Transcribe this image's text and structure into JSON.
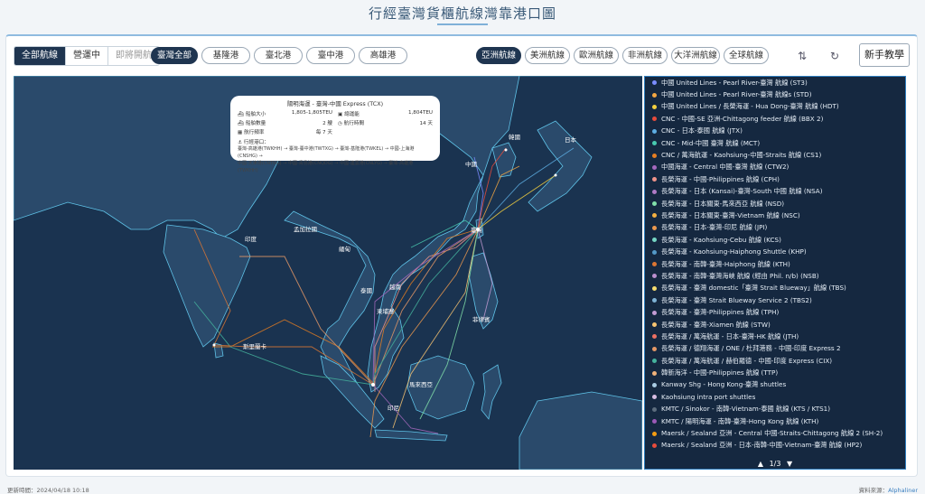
{
  "page": {
    "title": "行經臺灣貨櫃航線灣靠港口圖"
  },
  "toolbar": {
    "route_type": [
      {
        "label": "全部航線",
        "active": true
      },
      {
        "label": "營運中",
        "active": false
      },
      {
        "label": "即將開航",
        "active": false,
        "disabled": true
      }
    ],
    "ports": [
      {
        "label": "臺灣全部",
        "active": true
      },
      {
        "label": "基隆港",
        "active": false
      },
      {
        "label": "臺北港",
        "active": false
      },
      {
        "label": "臺中港",
        "active": false
      },
      {
        "label": "高雄港",
        "active": false
      }
    ],
    "regions": [
      {
        "label": "亞洲航線",
        "active": true
      },
      {
        "label": "美洲航線",
        "active": false
      },
      {
        "label": "歐洲航線",
        "active": false
      },
      {
        "label": "非洲航線",
        "active": false
      },
      {
        "label": "大洋洲航線",
        "active": false
      },
      {
        "label": "全球航線",
        "active": false
      }
    ],
    "sort_icon": "sort-arrows-icon",
    "refresh_icon": "refresh-icon",
    "tutorial_label": "新手教學"
  },
  "infobox": {
    "title": "陽明海運 - 臺灣-中國 Express (TCX)",
    "fields": [
      {
        "icon": "ship-icon",
        "label": "船舶大小",
        "value": "1,805-1,805TEU"
      },
      {
        "icon": "container-icon",
        "label": "總運能",
        "value": "1,804TEU"
      },
      {
        "icon": "ship-icon",
        "label": "船舶數量",
        "value": "2 艘"
      },
      {
        "icon": "clock-icon",
        "label": "航行時間",
        "value": "14 天"
      },
      {
        "icon": "calendar-icon",
        "label": "航行頻率",
        "value": "每 7 天"
      }
    ],
    "ports_title": "行經港口：",
    "ports_line1": "臺灣-高雄港(TWKHH) → 臺灣-臺中港(TWTXG) → 臺灣-基隆港(TWKEL) → 中國-上海港(CNSHG) →",
    "ports_line2": "中國-天津港(CNTNG) → 中國-青島港(CNQDG) → 中國-連雲港(CNLYG) → 臺灣-高雄港(TWKHH)"
  },
  "map": {
    "labels": [
      {
        "id": "korea",
        "text": "韓國"
      },
      {
        "id": "japan",
        "text": "日本"
      },
      {
        "id": "china",
        "text": "中國"
      },
      {
        "id": "taiwan",
        "text": "臺灣"
      },
      {
        "id": "india",
        "text": "印度"
      },
      {
        "id": "bangladesh",
        "text": "孟加拉國"
      },
      {
        "id": "myanmar",
        "text": "緬甸"
      },
      {
        "id": "thailand",
        "text": "泰國"
      },
      {
        "id": "cambodia",
        "text": "柬埔寨"
      },
      {
        "id": "vietnam",
        "text": "越南"
      },
      {
        "id": "philippines",
        "text": "菲律賓"
      },
      {
        "id": "srilanka",
        "text": "斯里蘭卡"
      },
      {
        "id": "malaysia",
        "text": "馬來西亞"
      },
      {
        "id": "indonesia",
        "text": "印尼"
      }
    ]
  },
  "legend": {
    "items": [
      {
        "label": "中國 United Lines - Pearl River-臺灣 航線 (ST3)",
        "color": "#7b8cff"
      },
      {
        "label": "中國 United Lines - Pearl River-臺灣 航線s (STD)",
        "color": "#f4a742"
      },
      {
        "label": "中國 United Lines / 長榮海運 - Hua Dong-臺灣 航線 (HDT)",
        "color": "#f4d03f"
      },
      {
        "label": "CNC - 中國-SE 亞洲-Chittagong feeder 航線 (BBX 2)",
        "color": "#e74c3c"
      },
      {
        "label": "CNC - 日本-泰國 航線 (JTX)",
        "color": "#5dade2"
      },
      {
        "label": "CNC - Mid-中國 臺灣 航線 (MCT)",
        "color": "#48c9b0"
      },
      {
        "label": "CNC / 萬海航運 - Kaohsiung-中國-Straits 航線 (CS1)",
        "color": "#e67e22"
      },
      {
        "label": "中國海運 - Central 中國-臺灣 航線 (CTW2)",
        "color": "#a569bd"
      },
      {
        "label": "長榮海運 - 中國-Philippines 航線 (CPH)",
        "color": "#f1948a"
      },
      {
        "label": "長榮海運 - 日本 (Kansai)-臺灣-South 中國 航線 (NSA)",
        "color": "#af7ac5"
      },
      {
        "label": "長榮海運 - 日本關東-馬來西亞 航線 (NSD)",
        "color": "#82e0aa"
      },
      {
        "label": "長榮海運 - 日本關東-臺灣-Vietnam 航線 (NSC)",
        "color": "#f5b041"
      },
      {
        "label": "長榮海運 - 日本-臺灣-印尼 航線 (JPI)",
        "color": "#eb984e"
      },
      {
        "label": "長榮海運 - Kaohsiung-Cebu 航線 (KCS)",
        "color": "#76d7c4"
      },
      {
        "label": "長榮海運 - Kaohsiung-Haiphong Shuttle (KHP)",
        "color": "#5499c7"
      },
      {
        "label": "長榮海運 - 南韓-臺灣-Haiphong 航線 (KTH)",
        "color": "#dc7633"
      },
      {
        "label": "長榮海運 - 南韓-臺灣海峽 航線 (經由 Phil. n/b) (NSB)",
        "color": "#bb8fce"
      },
      {
        "label": "長榮海運 - 臺灣 domestic「臺灣 Strait Blueway」航線 (TBS)",
        "color": "#f7dc6f"
      },
      {
        "label": "長榮海運 - 臺灣 Strait Blueway Service 2 (TBS2)",
        "color": "#7fb3d5"
      },
      {
        "label": "長榮海運 - 臺灣-Philippines 航線 (TPH)",
        "color": "#c39bd3"
      },
      {
        "label": "長榮海運 - 臺灣-Xiamen 航線 (STW)",
        "color": "#f8c471"
      },
      {
        "label": "長榮海運 / 萬海航運 - 日本-臺灣-HK 航線 (JTH)",
        "color": "#ec7063"
      },
      {
        "label": "長榮海運 / 德翔海運 / ONE / 杜拜港務 - 中國-印度 Express 2",
        "color": "#e59866"
      },
      {
        "label": "長榮海運 / 萬海航運 / 赫伯羅德 - 中國-印度 Express (CIX)",
        "color": "#45b39d"
      },
      {
        "label": "韓新海洋 - 中國-Philippines 航線 (TTP)",
        "color": "#f0b27a"
      },
      {
        "label": "Kanway Shg - Hong Kong-臺灣 shuttles",
        "color": "#a9cce3"
      },
      {
        "label": "Kaohsiung intra port shuttles",
        "color": "#d7bde2"
      },
      {
        "label": "KMTC / Sinokor - 南韓-Vietnam-泰國 航線 (KTS / KTS1)",
        "color": "#5d6d7e"
      },
      {
        "label": "KMTC / 陽明海運 - 南韓-臺灣-Hong Kong 航線 (KTH)",
        "color": "#9b59b6"
      },
      {
        "label": "Maersk / Sealand 亞洲 - Central 中國-Straits-Chittagong 航線 2 (SH-2)",
        "color": "#f39c12"
      },
      {
        "label": "Maersk / Sealand 亞洲 - 日本-南韓-中國-Vietnam-臺灣 航線 (HP2)",
        "color": "#e74c3c"
      }
    ],
    "page": "1/3",
    "prev_icon": "triangle-up-icon",
    "next_icon": "triangle-down-icon"
  },
  "footer": {
    "updated": "更新時間：2024/04/18 10:18",
    "source_label": "資料來源：",
    "source": "Alphaliner"
  },
  "colors": {
    "ocean": "#1a3350",
    "land": "#2a4a6b",
    "border": "#5fc3e8",
    "accent": "#1f3550"
  }
}
